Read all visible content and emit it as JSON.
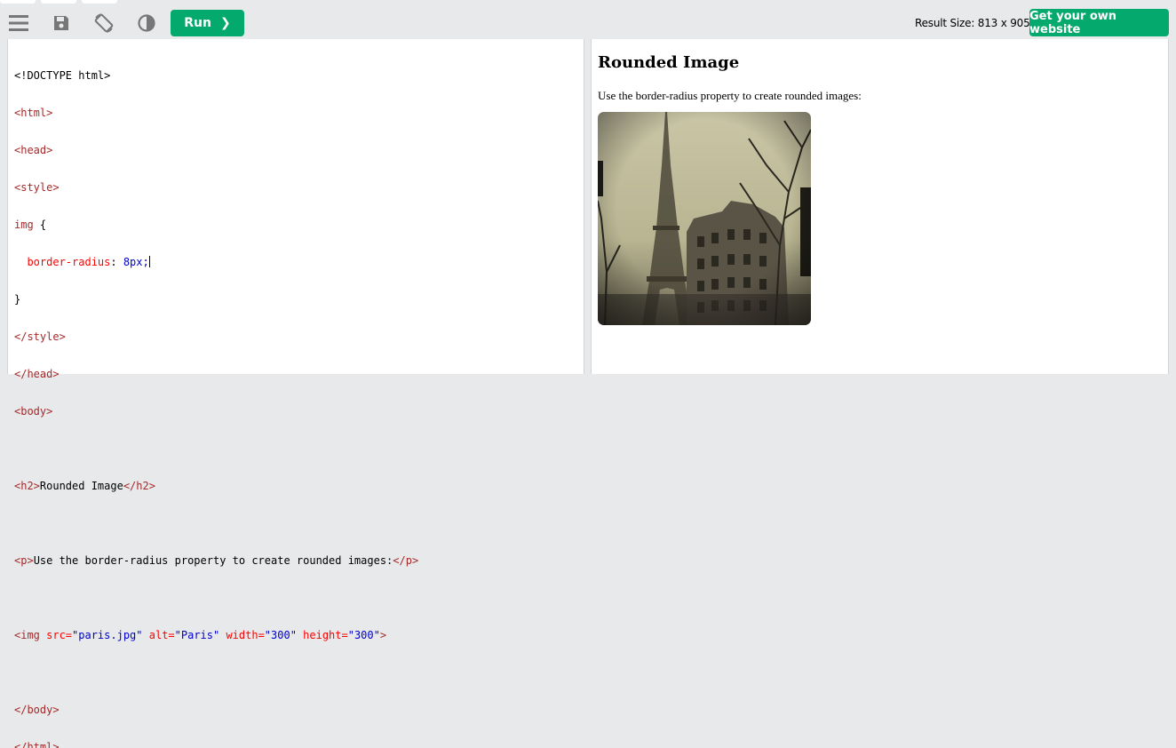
{
  "toolbar": {
    "icons": [
      "menu-icon",
      "save-icon",
      "rotate-icon",
      "contrast-icon"
    ],
    "run_label": "Run",
    "run_chevron": "❯",
    "result_size_text": "Result Size: 813 x 905",
    "own_website_label": "Get your own website"
  },
  "editor": {
    "lines": {
      "l1": "<!DOCTYPE html>",
      "l2": "<html>",
      "l3": "<head>",
      "l4": "<style>",
      "l5_selector": "img",
      "l5_brace": " {",
      "l6_prop": "  border-radius",
      "l6_colon": ": ",
      "l6_val": "8px;",
      "l7": "}",
      "l8": "</style>",
      "l9": "</head>",
      "l10": "<body>",
      "l12_open": "<h2>",
      "l12_text": "Rounded Image",
      "l12_close": "</h2>",
      "l14_open": "<p>",
      "l14_text": "Use the border-radius property to create rounded images:",
      "l14_close": "</p>",
      "l16_tag": "<img",
      "l16_a1": " src=",
      "l16_v1": "\"paris.jpg\"",
      "l16_a2": " alt=",
      "l16_v2": "\"Paris\"",
      "l16_a3": " width=",
      "l16_v3": "\"300\"",
      "l16_a4": " height=",
      "l16_v4": "\"300\"",
      "l16_end": ">",
      "l18": "</body>",
      "l19": "</html>"
    }
  },
  "result": {
    "heading": "Rounded Image",
    "paragraph": "Use the border-radius property to create rounded images:",
    "image_alt": "Paris"
  },
  "colors": {
    "accent": "#04aa6d",
    "toolbar_bg": "#e7e9eb",
    "tag": "#a52a2a",
    "attr": "#ff0000",
    "value": "#0000cd"
  }
}
